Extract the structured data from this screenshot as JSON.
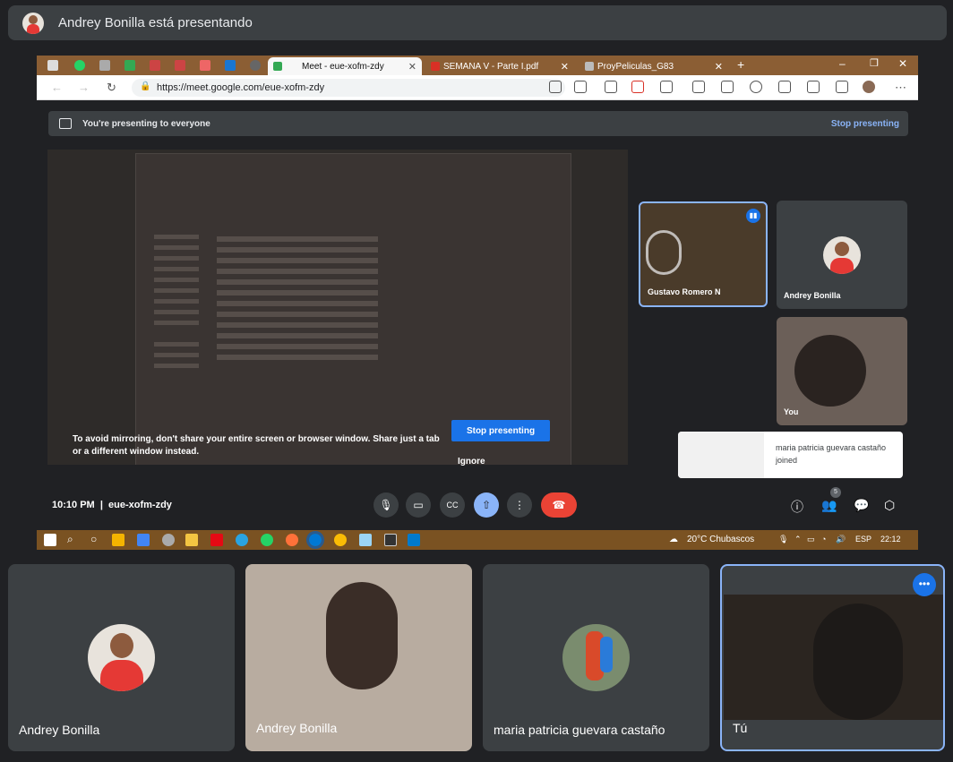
{
  "presenter_bar": {
    "text": "Andrey Bonilla está presentando",
    "avatar_icon": "user-avatar"
  },
  "shared_screen": {
    "browser_tabs": [
      {
        "label": "Meet - eue-xofm-zdy",
        "active": true
      },
      {
        "label": "SEMANA V - Parte I.pdf"
      },
      {
        "label": "ProyPeliculas_G83"
      }
    ],
    "address": "https://meet.google.com/eue-xofm-zdy",
    "presenting_banner": {
      "text": "You're presenting to everyone",
      "stop": "Stop presenting"
    },
    "mirror_warning": "To avoid mirroring, don't share your entire screen or browser window. Share just a tab or a different window instead.",
    "stop_button": "Stop presenting",
    "ignore": "Ignore",
    "participants": [
      {
        "name": "Gustavo Romero N",
        "speaking": true
      },
      {
        "name": "Andrey Bonilla"
      },
      {
        "name": "You"
      }
    ],
    "toast": "maria patricia guevara castaño joined",
    "meeting_time": "10:10 PM",
    "meeting_code": "eue-xofm-zdy",
    "people_count": "5",
    "taskbar": {
      "weather": "20°C  Chubascos",
      "lang": "ESP",
      "clock": "22:12"
    }
  },
  "bottom_tiles": [
    {
      "name": "Andrey Bonilla",
      "type": "avatar"
    },
    {
      "name": "Andrey Bonilla",
      "type": "video"
    },
    {
      "name": "maria patricia guevara castaño",
      "type": "avatar"
    },
    {
      "name": "Tú",
      "type": "video",
      "highlighted": true
    }
  ],
  "colors": {
    "accent": "#8ab4f8",
    "button_blue": "#1a73e8",
    "end_call": "#ea4335",
    "panel": "#3c4043"
  }
}
